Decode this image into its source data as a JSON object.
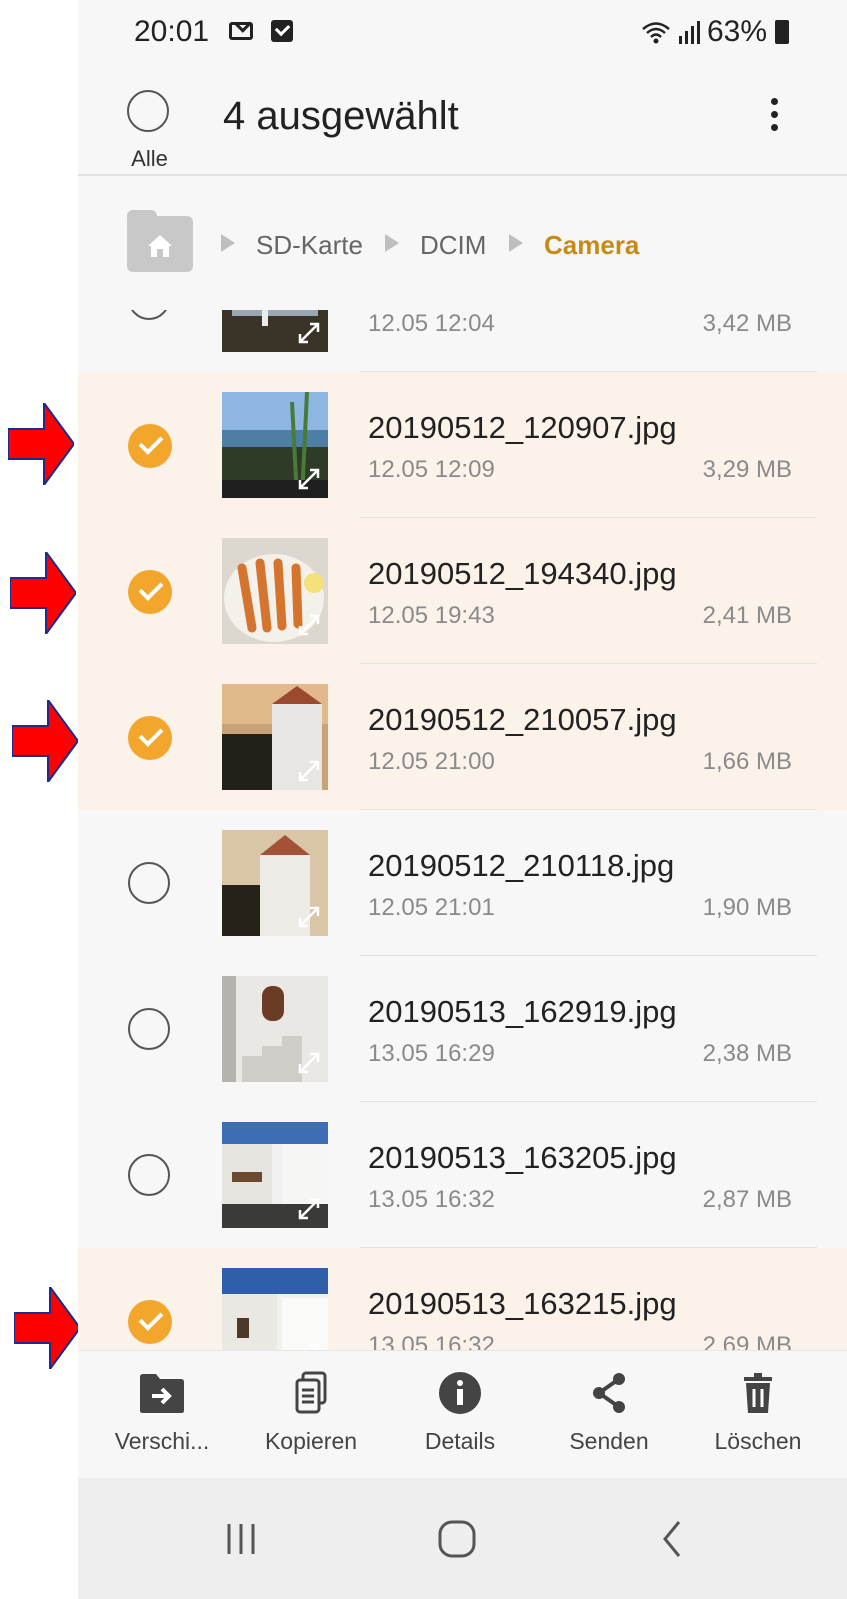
{
  "status_bar": {
    "time": "20:01",
    "battery": "63%"
  },
  "header": {
    "all_label": "Alle",
    "title": "4 ausgewählt"
  },
  "breadcrumb": {
    "items": [
      "SD-Karte",
      "DCIM",
      "Camera"
    ]
  },
  "files": [
    {
      "name": "",
      "date": "12.05 12:04",
      "size": "3,42 MB",
      "selected": false
    },
    {
      "name": "20190512_120907.jpg",
      "date": "12.05 12:09",
      "size": "3,29 MB",
      "selected": true
    },
    {
      "name": "20190512_194340.jpg",
      "date": "12.05 19:43",
      "size": "2,41 MB",
      "selected": true
    },
    {
      "name": "20190512_210057.jpg",
      "date": "12.05 21:00",
      "size": "1,66 MB",
      "selected": true
    },
    {
      "name": "20190512_210118.jpg",
      "date": "12.05 21:01",
      "size": "1,90 MB",
      "selected": false
    },
    {
      "name": "20190513_162919.jpg",
      "date": "13.05 16:29",
      "size": "2,38 MB",
      "selected": false
    },
    {
      "name": "20190513_163205.jpg",
      "date": "13.05 16:32",
      "size": "2,87 MB",
      "selected": false
    },
    {
      "name": "20190513_163215.jpg",
      "date": "13.05 16:32",
      "size": "2,69 MB",
      "selected": true
    }
  ],
  "actions": [
    {
      "label": "Verschi...",
      "icon": "move-icon"
    },
    {
      "label": "Kopieren",
      "icon": "copy-icon"
    },
    {
      "label": "Details",
      "icon": "info-icon"
    },
    {
      "label": "Senden",
      "icon": "share-icon"
    },
    {
      "label": "Löschen",
      "icon": "trash-icon"
    }
  ],
  "colors": {
    "accent": "#f2a62c",
    "breadcrumb_active": "#c88a17",
    "selected_row": "#fbf3ea",
    "annotation_arrow": "#ff0000"
  }
}
